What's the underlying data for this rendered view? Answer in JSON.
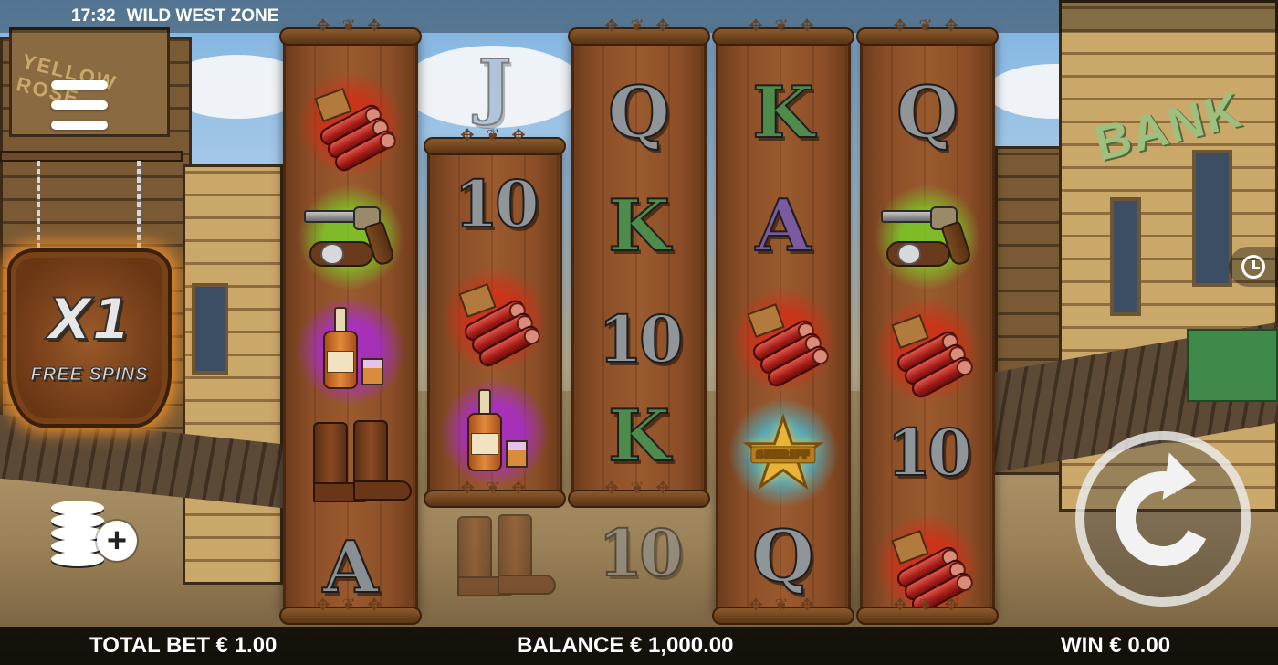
{
  "status_bar": {
    "time": "17:32",
    "game_title": "WILD WEST ZONE"
  },
  "background": {
    "bank_sign": "BANK",
    "saloon_sign": "YELLOW ROSE"
  },
  "free_spins": {
    "multiplier": "X1",
    "label": "FREE SPINS"
  },
  "buttons": {
    "menu_icon": "hamburger-menu-icon",
    "bet_icon": "coin-stack-plus-icon",
    "history_icon": "clock-icon",
    "spin_icon": "spin-arrow-icon"
  },
  "reels": [
    {
      "symbols": [
        "dynamite",
        "revolver",
        "whiskey",
        "boots",
        "A"
      ]
    },
    {
      "symbols": [
        "J",
        "10",
        "dynamite",
        "whiskey",
        "boots"
      ]
    },
    {
      "symbols": [
        "Q",
        "K",
        "10",
        "K",
        "10"
      ]
    },
    {
      "symbols": [
        "K",
        "A",
        "dynamite",
        "sheriff-star",
        "Q"
      ]
    },
    {
      "symbols": [
        "Q",
        "revolver",
        "dynamite",
        "10",
        "dynamite"
      ]
    }
  ],
  "sheriff_badge_text": "SHERIFF",
  "bottom_bar": {
    "total_bet": "TOTAL BET € 1.00",
    "balance": "BALANCE € 1,000.00",
    "win": "WIN € 0.00"
  },
  "colors": {
    "reel_wood": "#8b4e27",
    "card_green": "#4f8b4a",
    "card_purple": "#7b5aa1",
    "card_grey": "#8f9599",
    "glow_orange": "#ff9628"
  }
}
